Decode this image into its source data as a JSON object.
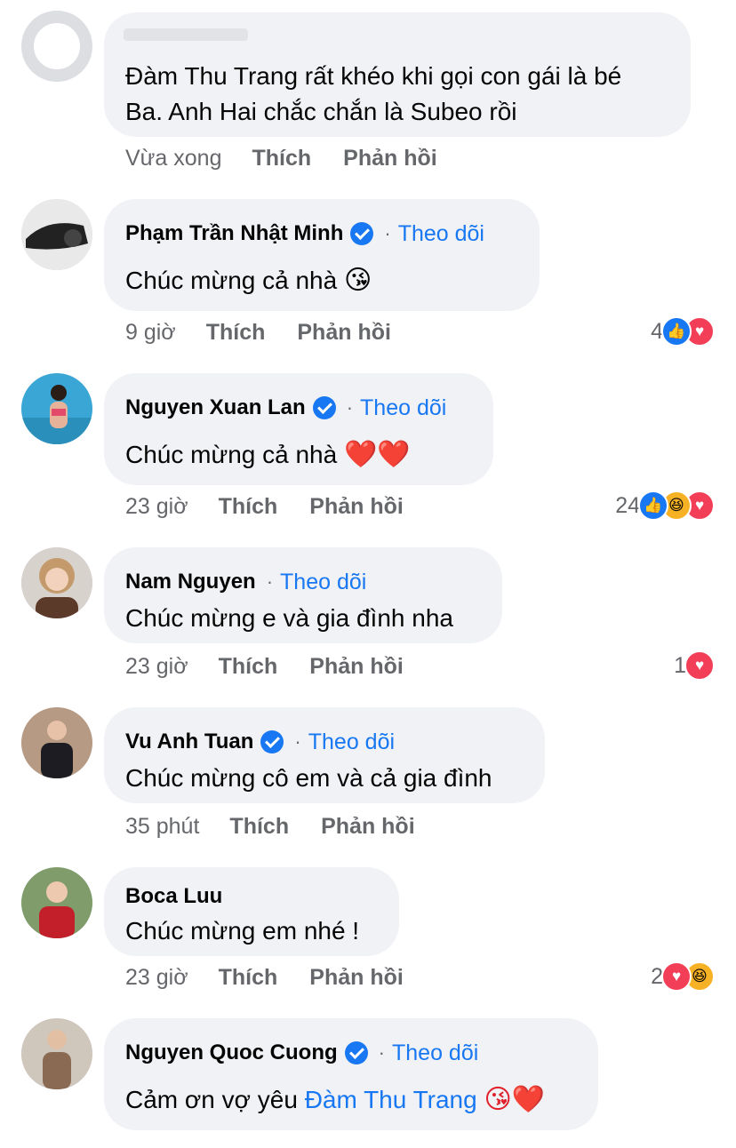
{
  "comments": [
    {
      "text_lines": [
        "Đàm Thu Trang rất khéo khi gọi con gái là bé",
        "Ba. Anh Hai chắc chắn là Subeo rồi"
      ],
      "time": "Vừa xong",
      "like": "Thích",
      "reply": "Phản hồi"
    },
    {
      "name": "Phạm Trần Nhật Minh",
      "verified": true,
      "follow": "Theo dõi",
      "text": "Chúc mừng cả nhà",
      "emoji": "😘",
      "time": "9 giờ",
      "like": "Thích",
      "reply": "Phản hồi",
      "reaction_count": "4",
      "reactions": [
        "like-icon",
        "love-icon"
      ]
    },
    {
      "name": "Nguyen Xuan Lan",
      "verified": true,
      "follow": "Theo dõi",
      "text": "Chúc mừng cả nhà",
      "emoji": "❤️❤️",
      "time": "23 giờ",
      "like": "Thích",
      "reply": "Phản hồi",
      "reaction_count": "24",
      "reactions": [
        "like-icon",
        "haha-icon",
        "love-icon"
      ]
    },
    {
      "name": "Nam Nguyen",
      "verified": false,
      "follow": "Theo dõi",
      "text": "Chúc mừng e và gia đình nha",
      "time": "23 giờ",
      "like": "Thích",
      "reply": "Phản hồi",
      "reaction_count": "1",
      "reactions": [
        "love-icon"
      ]
    },
    {
      "name": "Vu Anh Tuan",
      "verified": true,
      "follow": "Theo dõi",
      "text": "Chúc mừng cô em và cả gia đình",
      "time": "35 phút",
      "like": "Thích",
      "reply": "Phản hồi"
    },
    {
      "name": "Boca Luu",
      "verified": false,
      "text": "Chúc mừng em nhé !",
      "time": "23 giờ",
      "like": "Thích",
      "reply": "Phản hồi",
      "reaction_count": "2",
      "reactions": [
        "love-icon",
        "haha-icon"
      ]
    },
    {
      "name": "Nguyen Quoc Cuong",
      "verified": true,
      "follow": "Theo dõi",
      "text": "Cảm ơn vợ yêu",
      "mention": "Đàm Thu Trang",
      "emoji": "😘❤️"
    }
  ],
  "colors": {
    "link": "#1877f2",
    "bubble": "#f0f2f5",
    "meta": "#65676b"
  }
}
